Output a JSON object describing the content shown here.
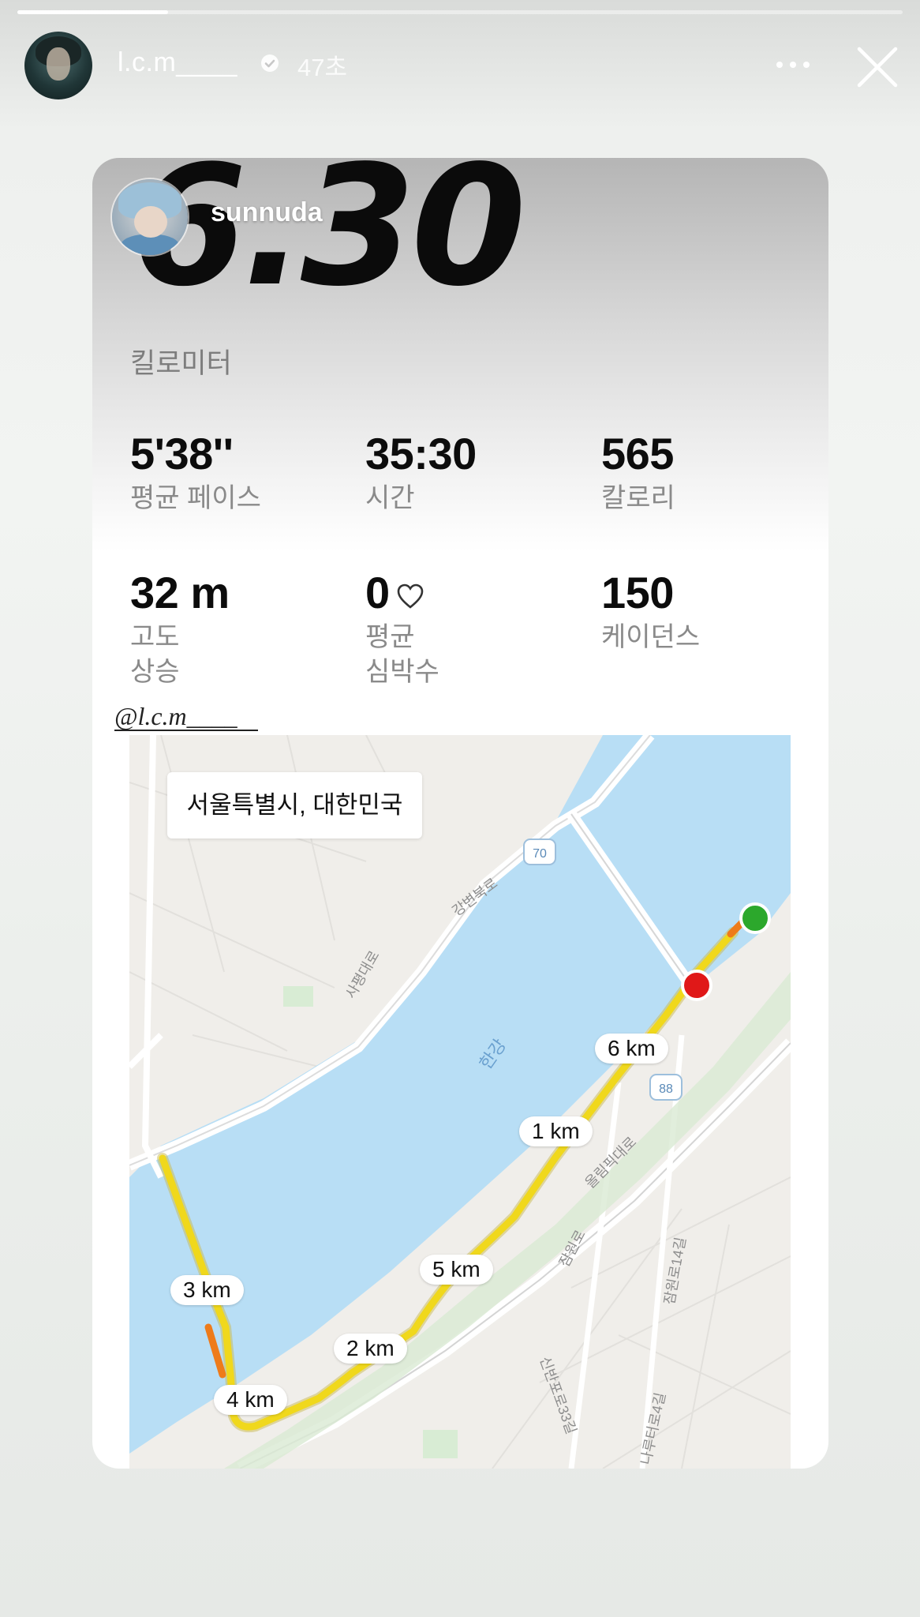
{
  "story": {
    "progress": 0.17,
    "username": "l.c.m____",
    "time_ago": "47초",
    "verified": true
  },
  "card": {
    "distance": "6.30",
    "tagged_user": "sunnuda",
    "unit": "킬로미터",
    "stats": [
      {
        "value": "5'38''",
        "label": "평균 페이스"
      },
      {
        "value": "35:30",
        "label": "시간"
      },
      {
        "value": "565",
        "label": "칼로리"
      },
      {
        "value": "32 m",
        "label": "고도\n상승"
      },
      {
        "value": "0",
        "label": "평균\n심박수",
        "icon": "heart-outline-icon"
      },
      {
        "value": "150",
        "label": "케이던스"
      }
    ],
    "mention": "@l.c.m____"
  },
  "map": {
    "location": "서울특별시, 대한민국",
    "km_markers": [
      "6 km",
      "1 km",
      "5 km",
      "3 km",
      "2 km",
      "4 km"
    ],
    "place_labels": [
      "한강",
      "강변북로",
      "올림픽대로",
      "잠원로",
      "잠원로14길",
      "신반포로33길",
      "나루터로4길",
      "사평대로"
    ],
    "route_shields": [
      "70",
      "88"
    ],
    "colors": {
      "water": "#b8def5",
      "land": "#f0eeea",
      "route": "#f0d81c",
      "start_marker": "#2ca82c",
      "end_marker": "#e01818"
    }
  }
}
